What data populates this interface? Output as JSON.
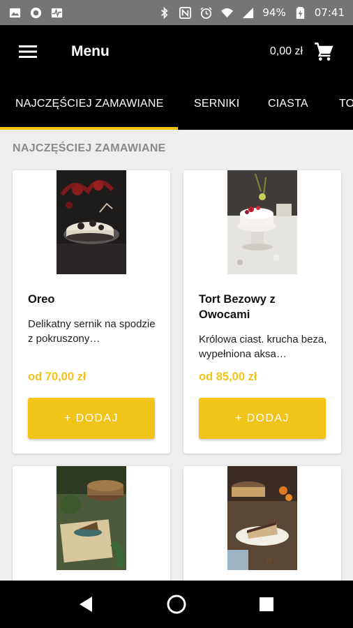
{
  "status_bar": {
    "battery": "94%",
    "time": "07:41",
    "left_icons": [
      "image-icon",
      "circle-icon",
      "pulse-icon"
    ],
    "right_icons": [
      "bluetooth-icon",
      "nfc-icon",
      "alarm-icon",
      "wifi-icon",
      "signal-icon",
      "battery-icon"
    ]
  },
  "app_bar": {
    "title": "Menu",
    "cart_total": "0,00 zł"
  },
  "tabs": [
    {
      "label": "NAJCZĘŚCIEJ ZAMAWIANE",
      "active": true
    },
    {
      "label": "SERNIKI",
      "active": false
    },
    {
      "label": "CIASTA",
      "active": false
    },
    {
      "label": "TO",
      "active": false
    }
  ],
  "section_title": "NAJCZĘŚCIEJ ZAMAWIANE",
  "products": [
    {
      "name": "Oreo",
      "description": "Delikatny sernik na spodzie z pokruszony…",
      "price": "od 70,00 zł",
      "button_label": "+ DODAJ"
    },
    {
      "name": "Tort Bezowy z Owocami",
      "description": "Królowa ciast. krucha beza, wypełniona aksa…",
      "price": "od 85,00 zł",
      "button_label": "+ DODAJ"
    },
    {
      "name": "",
      "description": "",
      "price": "",
      "button_label": ""
    },
    {
      "name": "",
      "description": "",
      "price": "",
      "button_label": ""
    }
  ],
  "colors": {
    "accent": "#f2c319",
    "app_bar": "#000000",
    "status_bar": "#757575",
    "background": "#eeeeee",
    "section_title": "#8a8a8a"
  },
  "nav_bar": {
    "icons": [
      "back-icon",
      "home-icon",
      "recents-icon"
    ]
  }
}
